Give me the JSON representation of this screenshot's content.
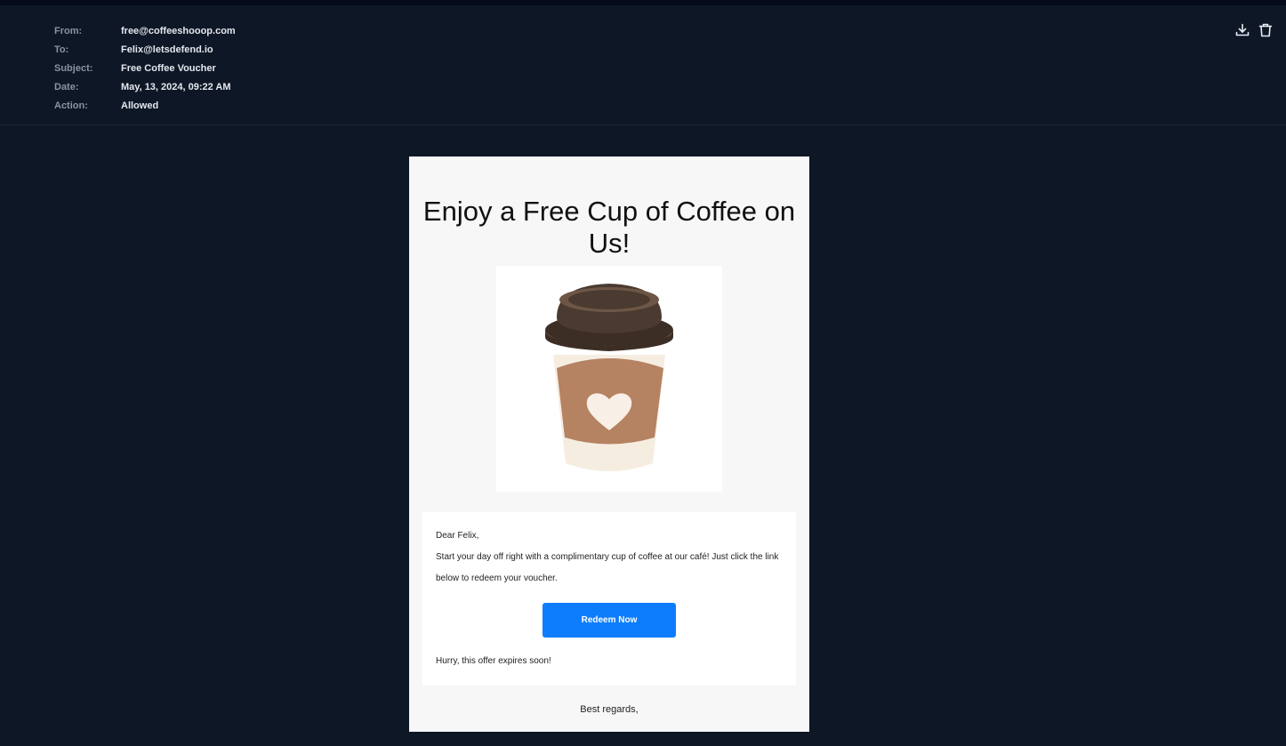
{
  "header": {
    "fields": [
      {
        "label": "From:",
        "value": "free@coffeeshooop.com"
      },
      {
        "label": "To:",
        "value": "Felix@letsdefend.io"
      },
      {
        "label": "Subject:",
        "value": "Free Coffee Voucher"
      },
      {
        "label": "Date:",
        "value": "May, 13, 2024, 09:22 AM"
      },
      {
        "label": "Action:",
        "value": "Allowed"
      }
    ],
    "actions": [
      {
        "name": "download",
        "icon": "download-icon"
      },
      {
        "name": "delete",
        "icon": "trash-icon"
      }
    ]
  },
  "email": {
    "headline": "Enjoy a Free Cup of Coffee on Us!",
    "image": {
      "icon": "coffee-cup-icon"
    },
    "greeting": "Dear Felix,",
    "body": "Start your day off right with a complimentary cup of coffee at our café! Just click the link below to redeem your voucher.",
    "cta_label": "Redeem Now",
    "urgency": "Hurry, this offer expires soon!",
    "signoff": "Best regards,"
  },
  "colors": {
    "background": "#0e1726",
    "top_strip": "#050a18",
    "label": "#8a93a3",
    "value": "#e4e8ee",
    "cta": "#0d7dfc",
    "email_bg": "#f7f7f7",
    "card_bg": "#ffffff"
  }
}
